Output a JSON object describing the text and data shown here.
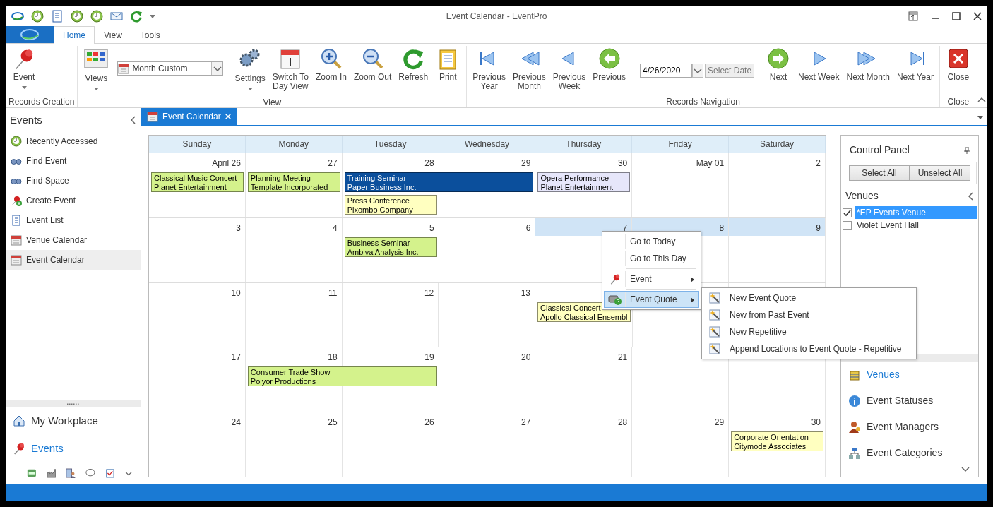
{
  "window": {
    "title": "Event Calendar - EventPro"
  },
  "ribbon_tabs": [
    {
      "label": "Home",
      "selected": true
    },
    {
      "label": "View",
      "selected": false
    },
    {
      "label": "Tools",
      "selected": false
    }
  ],
  "ribbon_groups": [
    {
      "label": "Records Creation",
      "items": [
        {
          "kind": "button",
          "label": "Event",
          "dropdown": true
        }
      ]
    },
    {
      "label": "View",
      "items": [
        {
          "kind": "button",
          "label": "Views",
          "dropdown": true
        },
        {
          "kind": "combo",
          "value": "Month Custom"
        },
        {
          "kind": "button",
          "label": "Settings",
          "dropdown": true
        },
        {
          "kind": "button",
          "label": "Switch To\nDay View",
          "dropdown": false
        },
        {
          "kind": "button",
          "label": "Zoom In",
          "dropdown": false
        },
        {
          "kind": "button",
          "label": "Zoom Out",
          "dropdown": false
        },
        {
          "kind": "button",
          "label": "Refresh",
          "dropdown": false
        },
        {
          "kind": "button",
          "label": "Print",
          "dropdown": false
        }
      ]
    },
    {
      "label": "Records Navigation",
      "items": [
        {
          "kind": "button",
          "label": "Previous\nYear",
          "dropdown": false
        },
        {
          "kind": "button",
          "label": "Previous\nMonth",
          "dropdown": false
        },
        {
          "kind": "button",
          "label": "Previous\nWeek",
          "dropdown": false
        },
        {
          "kind": "button",
          "label": "Previous",
          "dropdown": false
        },
        {
          "kind": "date",
          "value": "4/26/2020",
          "button": "Select Date"
        },
        {
          "kind": "button",
          "label": "Next",
          "dropdown": false
        },
        {
          "kind": "button",
          "label": "Next Week",
          "dropdown": false
        },
        {
          "kind": "button",
          "label": "Next Month",
          "dropdown": false
        },
        {
          "kind": "button",
          "label": "Next Year",
          "dropdown": false
        }
      ]
    },
    {
      "label": "Close",
      "items": [
        {
          "kind": "button",
          "label": "Close",
          "dropdown": false
        }
      ]
    }
  ],
  "nav_pane": {
    "title": "Events",
    "items": [
      {
        "label": "Recently Accessed",
        "selected": false
      },
      {
        "label": "Find Event",
        "selected": false
      },
      {
        "label": "Find Space",
        "selected": false
      },
      {
        "label": "Create Event",
        "selected": false
      },
      {
        "label": "Event List",
        "selected": false
      },
      {
        "label": "Venue Calendar",
        "selected": false
      },
      {
        "label": "Event Calendar",
        "selected": true
      }
    ],
    "groups": [
      {
        "label": "My Workplace",
        "selected": false
      },
      {
        "label": "Events",
        "selected": true
      }
    ]
  },
  "document_tabs": [
    {
      "label": "Event Calendar",
      "selected": true
    }
  ],
  "calendar": {
    "weekdays": [
      "Sunday",
      "Monday",
      "Tuesday",
      "Wednesday",
      "Thursday",
      "Friday",
      "Saturday"
    ],
    "weeks": [
      {
        "days": [
          {
            "date": "April 26",
            "selected": false,
            "events": [
              {
                "title": "Classical Music Concert",
                "client": "Planet Entertainment",
                "color": "#d4f28c"
              }
            ]
          },
          {
            "date": "27",
            "selected": false,
            "events": [
              {
                "title": "Planning Meeting",
                "client": "Template Incorporated",
                "color": "#d4f28c"
              }
            ]
          },
          {
            "date": "28",
            "selected": false,
            "events": [
              {
                "title": "Training Seminar",
                "client": "Paper Business Inc.",
                "color": "#0b4f9c",
                "spans_next_day": true
              },
              {
                "title": "Press Conference",
                "client": "Pixombo Company",
                "color": "#ffffc0"
              }
            ]
          },
          {
            "date": "29",
            "selected": false
          },
          {
            "date": "30",
            "selected": false,
            "events": [
              {
                "title": "Opera Performance",
                "client": "Planet Entertainment",
                "color": "#e6e6fa"
              }
            ]
          },
          {
            "date": "May 01",
            "selected": false
          },
          {
            "date": "2",
            "selected": false
          }
        ]
      },
      {
        "days": [
          {
            "date": "3",
            "selected": false
          },
          {
            "date": "4",
            "selected": false
          },
          {
            "date": "5",
            "selected": false,
            "events": [
              {
                "title": "Business Seminar",
                "client": "Ambiva Analysis Inc.",
                "color": "#d4f28c"
              }
            ]
          },
          {
            "date": "6",
            "selected": false
          },
          {
            "date": "7",
            "selected": true
          },
          {
            "date": "8",
            "selected": true
          },
          {
            "date": "9",
            "selected": true
          }
        ]
      },
      {
        "days": [
          {
            "date": "10",
            "selected": false
          },
          {
            "date": "11",
            "selected": false
          },
          {
            "date": "12",
            "selected": false
          },
          {
            "date": "13",
            "selected": false
          },
          {
            "events": [
              {
                "title": "Classical Concert",
                "client": "Apollo Classical Ensembl",
                "color": "#ffffc0"
              }
            ]
          }
        ]
      },
      {
        "days": [
          {
            "date": "17",
            "selected": false
          },
          {
            "date": "18",
            "selected": false,
            "events": [
              {
                "title": "Consumer Trade Show",
                "client": "Polyor Productions",
                "color": "#d4f28c",
                "spans_next_day": true
              }
            ]
          },
          {
            "date": "19",
            "selected": false
          },
          {
            "date": "20",
            "selected": false
          },
          {
            "date": "21",
            "selected": false
          }
        ]
      },
      {
        "days": [
          {
            "date": "24",
            "selected": false
          },
          {
            "date": "25",
            "selected": false
          },
          {
            "date": "26",
            "selected": false
          },
          {
            "date": "27",
            "selected": false
          },
          {
            "date": "28",
            "selected": false
          },
          {
            "date": "29",
            "selected": false
          },
          {
            "date": "30",
            "selected": false,
            "events": [
              {
                "title": "Corporate Orientation",
                "client": "Citymode Associates",
                "color": "#ffffc0"
              }
            ]
          }
        ]
      }
    ]
  },
  "context_menu": {
    "items": [
      {
        "kind": "item",
        "label": "Go to Today",
        "submenu": false,
        "selected": false
      },
      {
        "kind": "item",
        "label": "Go to This Day",
        "submenu": false,
        "selected": false
      },
      {
        "kind": "separator"
      },
      {
        "kind": "item",
        "label": "Event",
        "submenu": true,
        "selected": false
      },
      {
        "kind": "separator"
      },
      {
        "kind": "item",
        "label": "Event Quote",
        "submenu": true,
        "selected": true
      }
    ]
  },
  "submenu": {
    "items": [
      {
        "label": "New Event Quote"
      },
      {
        "label": "New from Past Event"
      },
      {
        "label": "New Repetitive"
      },
      {
        "label": "Append Locations to Event Quote - Repetitive"
      }
    ]
  },
  "control_panel": {
    "title": "Control Panel",
    "buttons": [
      "Select All",
      "Unselect All"
    ],
    "section": "Venues",
    "venues": [
      {
        "label": "*EP Events Venue",
        "checked": true,
        "selected": true
      },
      {
        "label": "Violet Event Hall",
        "checked": false,
        "selected": false
      }
    ],
    "nav_items": [
      {
        "label": "Venues",
        "selected": true
      },
      {
        "label": "Event Statuses",
        "selected": false
      },
      {
        "label": "Event Managers",
        "selected": false
      },
      {
        "label": "Event Categories",
        "selected": false
      }
    ]
  }
}
